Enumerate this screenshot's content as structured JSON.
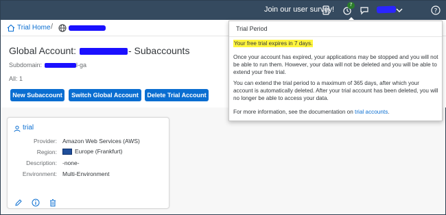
{
  "shell": {
    "survey_text": "Join our user survey!",
    "notification_count": "7"
  },
  "breadcrumb": {
    "home_label": "Trial Home",
    "separator": "/"
  },
  "header": {
    "title_prefix": "Global Account: ",
    "title_suffix": "- Subaccounts",
    "subdomain_label": "Subdomain:",
    "subdomain_suffix": "l-ga",
    "all_count": "All: 1"
  },
  "buttons": {
    "new_subaccount": "New Subaccount",
    "switch_global": "Switch Global Account",
    "delete_trial": "Delete Trial Account"
  },
  "tile": {
    "name": "trial",
    "provider_label": "Provider:",
    "provider_value": "Amazon Web Services (AWS)",
    "region_label": "Region:",
    "region_value": "Europe (Frankfurt)",
    "description_label": "Description:",
    "description_value": "-none-",
    "environment_label": "Environment:",
    "environment_value": "Multi-Environment"
  },
  "popover": {
    "title": "Trial Period",
    "highlight": "Your free trial expires in 7 days.",
    "para1": "Once your account has expired, your applications may be stopped and you will not be able to run them. However, your data will not be deleted and you will be able to extend your free trial.",
    "para2": "You can extend the trial period to a maximum of 365 days, after which your account is automatically deleted. After your trial account has been deleted, you will no longer be able to access your data.",
    "para3_prefix": "For more information, see the documentation on ",
    "para3_link": "trial accounts",
    "para3_suffix": "."
  },
  "colors": {
    "shell": "#354a5f",
    "accent": "#0a6ed1",
    "highlight": "#fff53d",
    "redaction": "#1b10ff"
  }
}
